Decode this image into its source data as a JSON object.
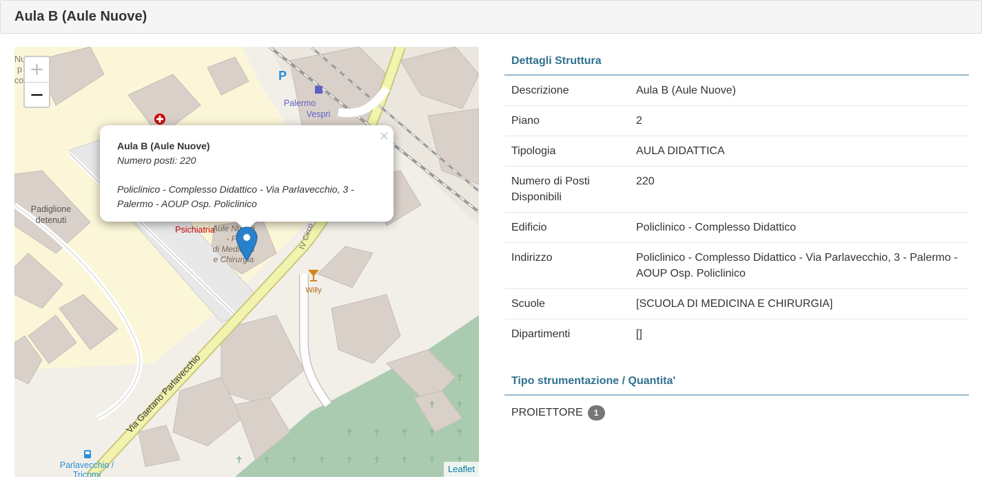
{
  "page": {
    "title": "Aula B (Aule Nuove)"
  },
  "map": {
    "zoom_in": "+",
    "zoom_out": "−",
    "attribution": "Leaflet",
    "labels": {
      "station_1": "Palermo",
      "station_2": "Vespri",
      "padiglione_1": "Padiglione",
      "padiglione_2": "detenuti",
      "psichiatria": "Psichiatria",
      "aule_1": "Aule Nuove",
      "aule_2": "- Fo",
      "aule_3": "di Medicina",
      "aule_4": "e Chirurgia",
      "street": "Via Gaetano Parlavecchio",
      "circ": "IV Circo",
      "willy": "Willy",
      "bus_1": "Parlavecchio /",
      "bus_2": "Tricomi",
      "parking": "P",
      "cut_1": "Nu",
      "cut_2": "p",
      "cut_3": "co"
    },
    "popup": {
      "title": "Aula B (Aule Nuove)",
      "seats": "Numero posti: 220",
      "address_line1": "Policlinico - Complesso Didattico - Via Parlavecchio, 3 -",
      "address_line2": "Palermo - AOUP Osp. Policlinico",
      "close": "×"
    }
  },
  "details": {
    "heading": "Dettagli Struttura",
    "rows": [
      {
        "label": "Descrizione",
        "value": "Aula B (Aule Nuove)"
      },
      {
        "label": "Piano",
        "value": "2"
      },
      {
        "label": "Tipologia",
        "value": "AULA DIDATTICA"
      },
      {
        "label": "Numero di Posti Disponibili",
        "value": "220"
      },
      {
        "label": "Edificio",
        "value": "Policlinico - Complesso Didattico"
      },
      {
        "label": "Indirizzo",
        "value": "Policlinico - Complesso Didattico - Via Parlavecchio, 3 - Palermo - AOUP Osp. Policlinico"
      },
      {
        "label": "Scuole",
        "value": "[SCUOLA DI MEDICINA E CHIRURGIA]"
      },
      {
        "label": "Dipartimenti",
        "value": "[]"
      }
    ]
  },
  "equipment": {
    "heading": "Tipo strumentazione / Quantita'",
    "items": [
      {
        "name": "PROIETTORE",
        "count": "1"
      }
    ]
  },
  "colors": {
    "heading": "#31708f",
    "marker": "#2a81cb",
    "badge": "#777777"
  },
  "icons": [
    "hospital-icon",
    "parking-icon",
    "station-icon",
    "bar-icon",
    "bus-stop-icon",
    "map-marker-icon",
    "close-icon"
  ]
}
